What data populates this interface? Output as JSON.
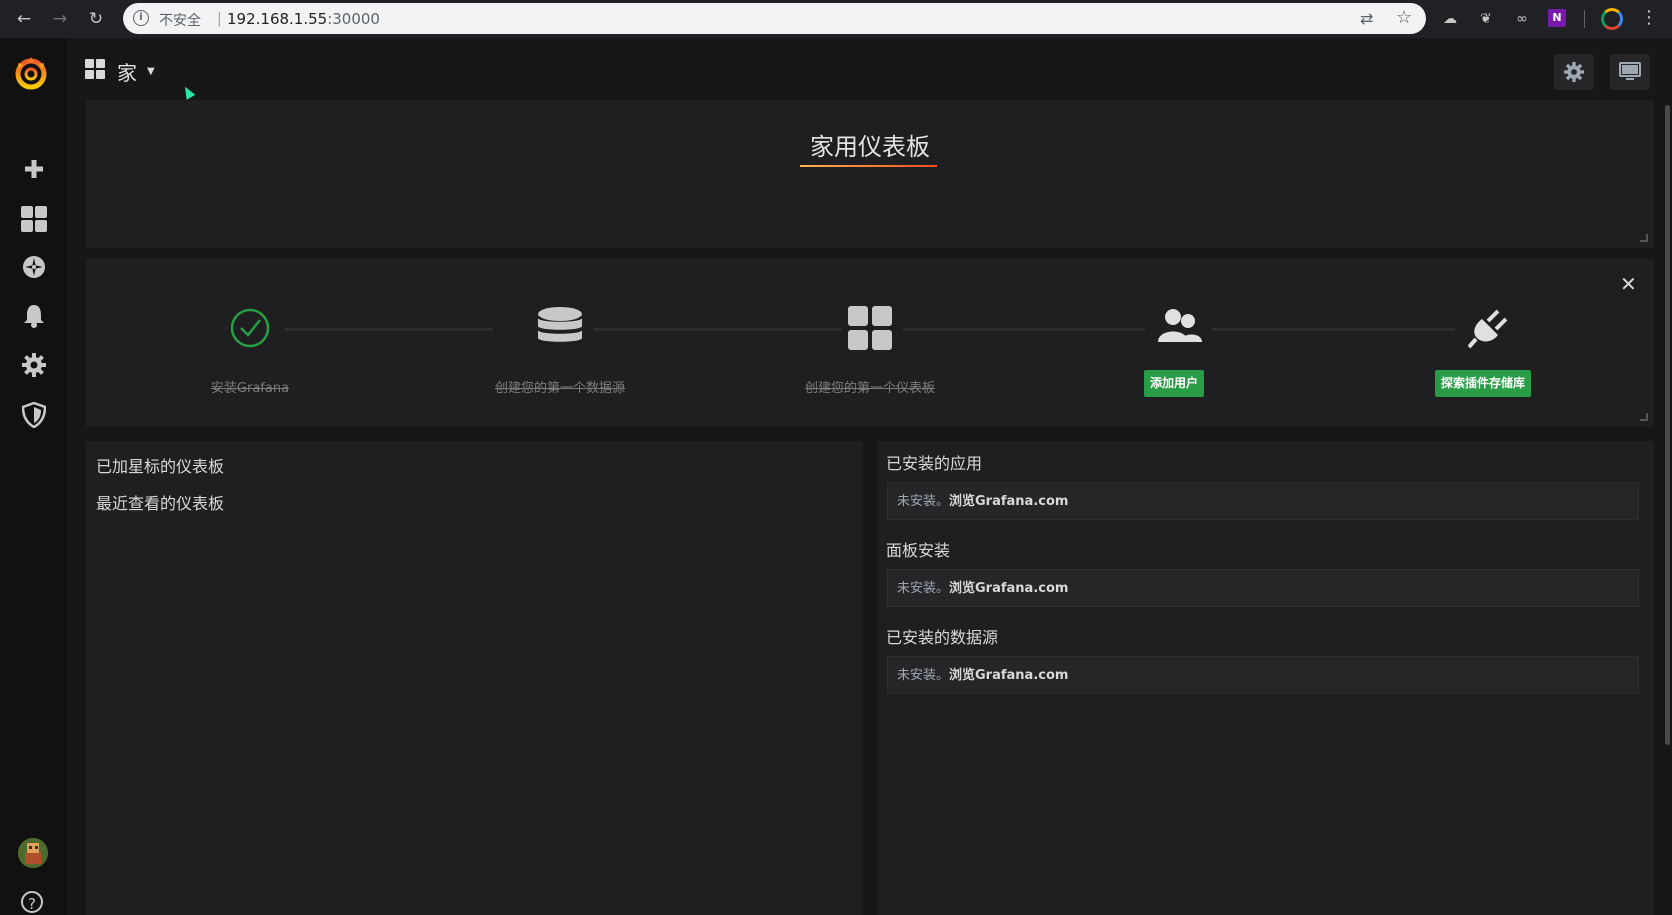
{
  "browser": {
    "insecure_label": "不安全",
    "separator": "|",
    "url_host": "192.168.1.55",
    "url_port": ":30000"
  },
  "navbar": {
    "dashboard_title": "家",
    "settings_icon": "gear-icon",
    "tv_icon": "monitor-icon"
  },
  "sidemenu": {
    "items": [
      {
        "icon": "plus-icon"
      },
      {
        "icon": "dashboards-icon"
      },
      {
        "icon": "explore-compass-icon"
      },
      {
        "icon": "bell-icon"
      },
      {
        "icon": "gear-icon"
      },
      {
        "icon": "shield-icon"
      }
    ],
    "help_label": "?"
  },
  "home_panel": {
    "title": "家用仪表板"
  },
  "getting_started": {
    "steps": [
      {
        "label": "安装Grafana",
        "done": true,
        "icon": "check-circle-icon"
      },
      {
        "label": "创建您的第一个数据源",
        "done": true,
        "icon": "database-icon"
      },
      {
        "label": "创建您的第一个仪表板",
        "done": true,
        "icon": "dashboards-icon"
      },
      {
        "button": "添加用户",
        "done": false,
        "icon": "users-icon"
      },
      {
        "button": "探索插件存储库",
        "done": false,
        "icon": "plug-icon"
      }
    ],
    "close_label": "✕"
  },
  "left_panel": {
    "starred": "已加星标的仪表板",
    "recent": "最近查看的仪表板"
  },
  "right_panel": {
    "sections": [
      {
        "title": "已安装的应用",
        "empty_prefix": "未安装。",
        "empty_link": "浏览Grafana.com"
      },
      {
        "title": "面板安装",
        "empty_prefix": "未安装。",
        "empty_link": "浏览Grafana.com"
      },
      {
        "title": "已安装的数据源",
        "empty_prefix": "未安装。",
        "empty_link": "浏览Grafana.com"
      }
    ]
  },
  "colors": {
    "background": "#161719",
    "panel": "#1f1f21",
    "success": "#299c46",
    "brand": "#f46800"
  }
}
